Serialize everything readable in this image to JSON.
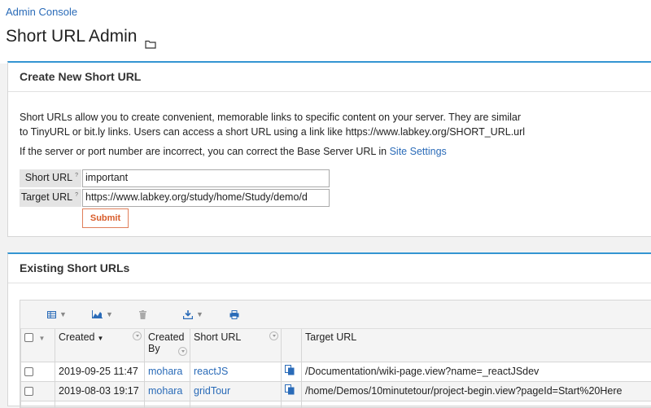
{
  "breadcrumb": "Admin Console",
  "page_title": "Short URL Admin",
  "create_panel": {
    "title": "Create New Short URL",
    "description_line1": "Short URLs allow you to create convenient, memorable links to specific content on your server. They are similar",
    "description_line2": "to TinyURL or bit.ly links. Users can access a short URL using a link like https://www.labkey.org/SHORT_URL.url",
    "server_note": "If the server or port number are incorrect, you can correct the Base Server URL in ",
    "site_settings_link": "Site Settings",
    "short_url_label": "Short URL",
    "short_url_value": "important",
    "target_url_label": "Target URL",
    "target_url_value": "https://www.labkey.org/study/home/Study/demo/d",
    "help_marker": "?",
    "submit_label": "Submit"
  },
  "existing_panel": {
    "title": "Existing Short URLs",
    "toolbar_icons": [
      "grid-views-icon",
      "charts-icon",
      "delete-icon",
      "export-icon",
      "print-icon"
    ],
    "columns": {
      "created": "Created",
      "created_by": "Created By",
      "short_url": "Short URL",
      "target_url": "Target URL"
    },
    "rows": [
      {
        "created": "2019-09-25 11:47",
        "created_by": "mohara",
        "short_url": "reactJS",
        "target_url": "/Documentation/wiki-page.view?name=_reactJSdev"
      },
      {
        "created": "2019-08-03 19:17",
        "created_by": "mohara",
        "short_url": "gridTour",
        "target_url": "/home/Demos/10minutetour/project-begin.view?pageId=Start%20Here"
      }
    ]
  },
  "colors": {
    "accent": "#3495d2",
    "link": "#2a6bb8",
    "submit": "#d85c2a"
  }
}
